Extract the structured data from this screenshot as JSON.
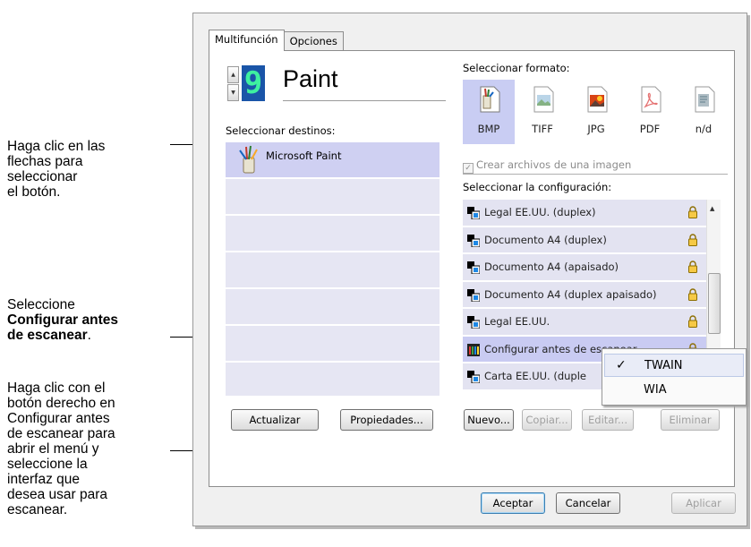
{
  "callouts": {
    "arrows_text": [
      "Haga clic en las",
      "flechas para",
      "seleccionar",
      "el botón."
    ],
    "config_text_lines": [
      "Seleccione"
    ],
    "config_text_bold_1": "Configurar antes",
    "config_text_bold_2": "de escanear",
    "config_text_tail": ".",
    "rightclick_text": [
      "Haga clic con el",
      "botón derecho en",
      "Configurar antes",
      "de escanear para",
      "abrir el menú y",
      "seleccione la",
      "interfaz que",
      "desea usar para",
      "escanear."
    ]
  },
  "tabs": [
    {
      "label": "Multifunción",
      "active": true
    },
    {
      "label": "Opciones",
      "active": false
    }
  ],
  "button_panel": {
    "digit": "9",
    "title": "Paint",
    "destinations_label": "Seleccionar destinos:",
    "destinations": [
      {
        "label": "Microsoft Paint",
        "selected": true,
        "icon": "paint-icon"
      },
      {
        "label": "",
        "selected": false
      },
      {
        "label": "",
        "selected": false
      },
      {
        "label": "",
        "selected": false
      },
      {
        "label": "",
        "selected": false
      },
      {
        "label": "",
        "selected": false
      },
      {
        "label": "",
        "selected": false
      }
    ],
    "update_button": "Actualizar",
    "properties_button": "Propiedades..."
  },
  "format": {
    "label": "Seleccionar formato:",
    "options": [
      {
        "label": "BMP",
        "selected": true,
        "icon": "bmp-icon"
      },
      {
        "label": "TIFF",
        "selected": false,
        "icon": "tiff-icon"
      },
      {
        "label": "JPG",
        "selected": false,
        "icon": "jpg-icon"
      },
      {
        "label": "PDF",
        "selected": false,
        "icon": "pdf-icon"
      },
      {
        "label": "n/d",
        "selected": false,
        "icon": "nd-icon"
      }
    ],
    "single_image_checkbox": "Crear archivos de una imagen",
    "single_image_checked": true
  },
  "configuration": {
    "label": "Seleccionar la configuración:",
    "items": [
      {
        "label": "Legal EE.UU. (duplex)",
        "selected": false
      },
      {
        "label": "Documento A4 (duplex)",
        "selected": false
      },
      {
        "label": "Documento A4 (apaisado)",
        "selected": false
      },
      {
        "label": "Documento A4 (duplex apaisado)",
        "selected": false
      },
      {
        "label": "Legal EE.UU.",
        "selected": false
      },
      {
        "label": "Configurar antes de escanear",
        "selected": true
      },
      {
        "label": "Carta EE.UU. (duple",
        "selected": false
      }
    ],
    "new_button": "Nuevo...",
    "copy_button": "Copiar...",
    "edit_button": "Editar...",
    "delete_button": "Eliminar"
  },
  "context_menu": {
    "items": [
      {
        "label": "TWAIN",
        "checked": true
      },
      {
        "label": "WIA",
        "checked": false
      }
    ]
  },
  "footer": {
    "ok_button": "Aceptar",
    "cancel_button": "Cancelar",
    "apply_button": "Aplicar"
  },
  "colors": {
    "selection": "#cfd0f2",
    "list_row": "#e6e6f3",
    "digit_bg": "#1a55a8",
    "digit_fg": "#3ef0a0"
  }
}
